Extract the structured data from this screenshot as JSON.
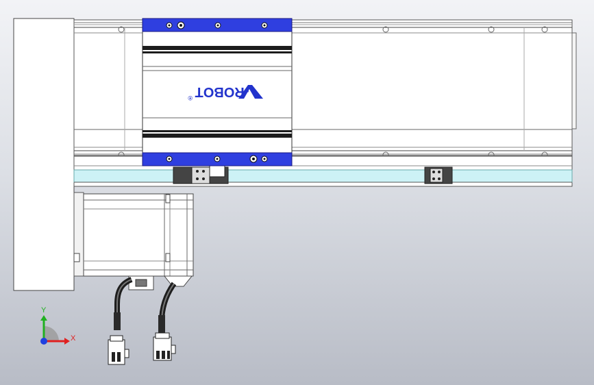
{
  "logo": {
    "text": "-ROBOT",
    "registered": "®"
  },
  "axes": {
    "x_label": "X",
    "y_label": "Y"
  },
  "colors": {
    "carriage_plate": "#2f3fe0",
    "guide_strip": "#cdf2f6",
    "logo": "#2233cc",
    "axis_x": "#e02020",
    "axis_y": "#20b020",
    "axis_z": "#2040e0"
  }
}
